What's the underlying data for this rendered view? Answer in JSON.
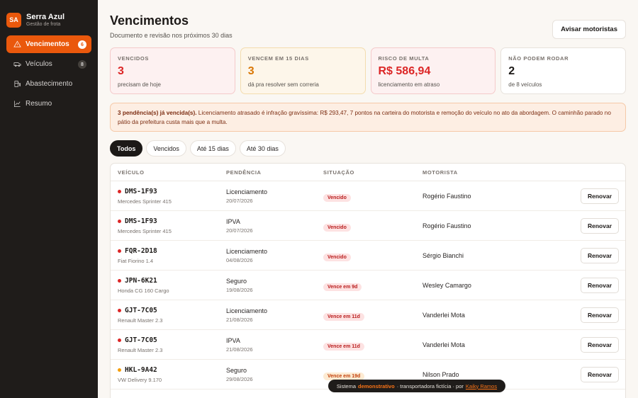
{
  "brand": {
    "initials": "SA",
    "name": "Serra Azul",
    "subtitle": "Gestão de frota"
  },
  "sidebar": {
    "items": [
      {
        "label": "Vencimentos",
        "badge": "6",
        "icon": "warning-icon",
        "active": true
      },
      {
        "label": "Veículos",
        "badge": "8",
        "icon": "van-icon",
        "active": false
      },
      {
        "label": "Abastecimento",
        "badge": "",
        "icon": "fuel-icon",
        "active": false
      },
      {
        "label": "Resumo",
        "badge": "",
        "icon": "chart-icon",
        "active": false
      }
    ]
  },
  "header": {
    "title": "Vencimentos",
    "subtitle": "Documento e revisão nos próximos 30 dias",
    "notify_label": "Avisar motoristas"
  },
  "cards": [
    {
      "label": "VENCIDOS",
      "value": "3",
      "note": "precisam de hoje",
      "color": "#dc2626"
    },
    {
      "label": "VENCEM EM 15 DIAS",
      "value": "3",
      "note": "dá pra resolver sem correria",
      "color": "#d97706"
    },
    {
      "label": "RISCO DE MULTA",
      "value": "R$ 586,94",
      "note": "licenciamento em atraso",
      "color": "#dc2626"
    },
    {
      "label": "NÃO PODEM RODAR",
      "value": "2",
      "note": "de 8 veículos",
      "color": "#1c1917"
    }
  ],
  "alert": {
    "strong": "3 pendência(s) já vencida(s).",
    "text": " Licenciamento atrasado é infração gravíssima: R$ 293,47, 7 pontos na carteira do motorista e remoção do veículo no ato da abordagem. O caminhão parado no pátio da prefeitura custa mais que a multa."
  },
  "filters": [
    "Todos",
    "Vencidos",
    "Até 15 dias",
    "Até 30 dias"
  ],
  "table": {
    "headers": [
      "VEÍCULO",
      "PENDÊNCIA",
      "SITUAÇÃO",
      "MOTORISTA"
    ],
    "action_label": "Renovar",
    "rows": [
      {
        "plate": "DMS-1F93",
        "model": "Mercedes Sprinter 415",
        "pending": "Licenciamento",
        "date": "20/07/2026",
        "status": "Vencido",
        "tone": "red",
        "driver": "Rogério Faustino"
      },
      {
        "plate": "DMS-1F93",
        "model": "Mercedes Sprinter 415",
        "pending": "IPVA",
        "date": "20/07/2026",
        "status": "Vencido",
        "tone": "red",
        "driver": "Rogério Faustino"
      },
      {
        "plate": "FQR-2D18",
        "model": "Fiat Fiorino 1.4",
        "pending": "Licenciamento",
        "date": "04/08/2026",
        "status": "Vencido",
        "tone": "red",
        "driver": "Sérgio Bianchi"
      },
      {
        "plate": "JPN-6K21",
        "model": "Honda CG 160 Cargo",
        "pending": "Seguro",
        "date": "19/08/2026",
        "status": "Vence em 9d",
        "tone": "red",
        "driver": "Wesley Camargo"
      },
      {
        "plate": "GJT-7C05",
        "model": "Renault Master 2.3",
        "pending": "Licenciamento",
        "date": "21/08/2026",
        "status": "Vence em 11d",
        "tone": "red",
        "driver": "Vanderlei Mota"
      },
      {
        "plate": "GJT-7C05",
        "model": "Renault Master 2.3",
        "pending": "IPVA",
        "date": "21/08/2026",
        "status": "Vence em 11d",
        "tone": "red",
        "driver": "Vanderlei Mota"
      },
      {
        "plate": "HKL-9A42",
        "model": "VW Delivery 9.170",
        "pending": "Seguro",
        "date": "29/08/2026",
        "status": "Vence em 19d",
        "tone": "amber",
        "driver": "Nilson Prado"
      }
    ]
  },
  "footer": {
    "prefix": "Sistema",
    "highlight": "demonstrativo",
    "middle": "· transportadora fictícia · por",
    "link": "Kaiky Ramos"
  },
  "colors": {
    "accent": "#ea580c",
    "red": "#dc2626",
    "amber": "#f59e0b",
    "sidebar": "#1f1c1a"
  }
}
